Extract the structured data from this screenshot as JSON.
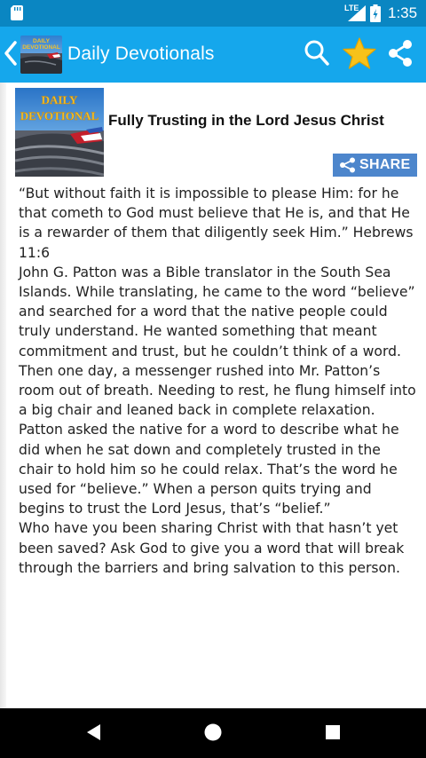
{
  "status_bar": {
    "network": "LTE",
    "time": "1:35",
    "icons": [
      "sd-card-icon",
      "signal-icon",
      "battery-icon"
    ]
  },
  "app_bar": {
    "title": "Daily Devotionals",
    "logo_text": "DAILY DEVOTIONAL",
    "actions": [
      "search-icon",
      "star-icon",
      "share-icon"
    ],
    "accent_color": "#15a7ec",
    "star_color": "#f7c21a"
  },
  "post": {
    "thumbnail_text_line1": "DAILY",
    "thumbnail_text_line2": "DEVOTIONAL",
    "title": "Fully Trusting in the Lord Jesus Christ",
    "share_label": "SHARE",
    "share_color": "#4d86cc",
    "paragraphs": [
      "“But without faith it is impossible to please Him: for he that cometh to God must believe that He is, and that He is a rewarder of them that diligently seek Him.” Hebrews 11:6",
      "John G. Patton was a Bible translator in the South Sea Islands. While translating, he came to the word “believe” and searched for a word that the native people could truly understand. He wanted something that meant commitment and trust, but he couldn’t think of a word. Then one day, a messenger rushed into Mr. Patton’s room out of breath. Needing to rest, he flung himself into a big chair and leaned back in complete relaxation. Patton asked the native for a word to describe what he did when he sat down and completely trusted in the chair to hold him so he could relax. That’s the word he used for “believe.” When a person quits trying and begins to trust the Lord Jesus, that’s “belief.”",
      "Who have you been sharing Christ with that hasn’t yet been saved? Ask God to give you a word that will break through the barriers and bring salvation to this person."
    ]
  },
  "nav_bar": {
    "buttons": [
      "back-triangle-icon",
      "home-circle-icon",
      "recents-square-icon"
    ]
  }
}
